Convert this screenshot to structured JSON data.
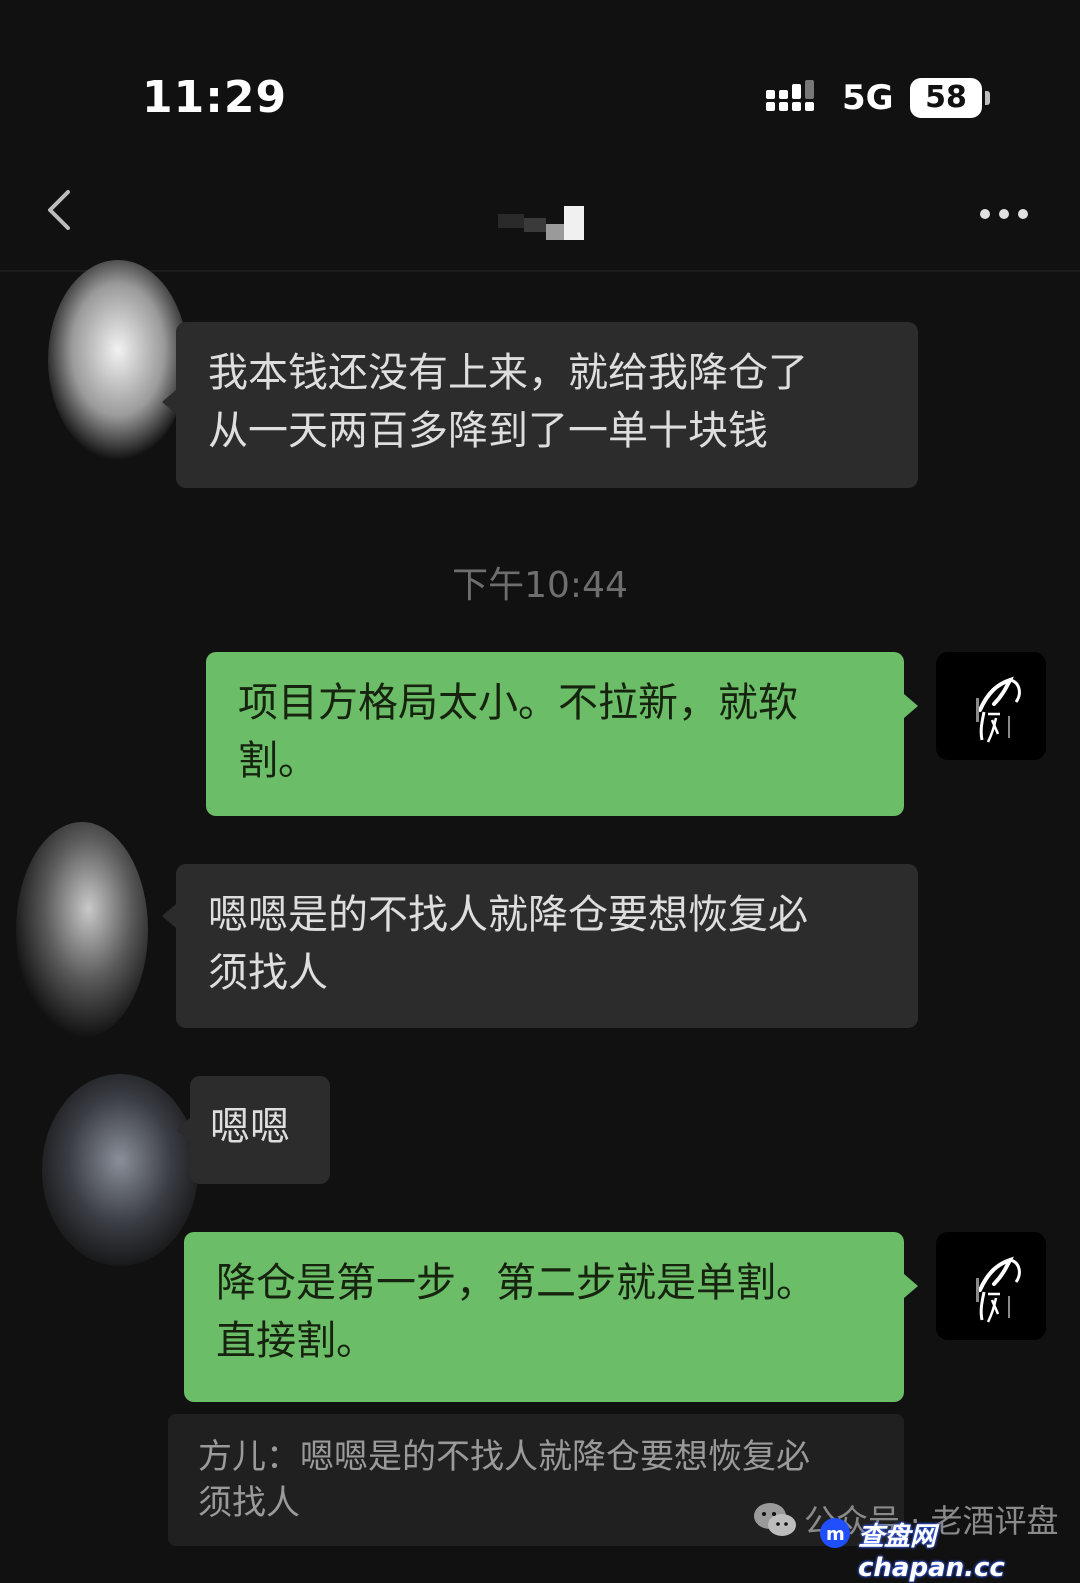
{
  "status_bar": {
    "time": "11:29",
    "network": "5G",
    "battery": "58"
  },
  "nav": {
    "back_icon": "chevron-left-icon",
    "more_icon": "ellipsis-icon"
  },
  "messages": [
    {
      "side": "in",
      "text": "我本钱还没有上来，就给我降仓了\n从一天两百多降到了一单十块钱"
    },
    {
      "type": "timestamp",
      "text": "下午10:44"
    },
    {
      "side": "out",
      "text": "项目方格局太小。不拉新，就软\n割。"
    },
    {
      "side": "in",
      "text": "嗯嗯是的不找人就降仓要想恢复必\n须找人"
    },
    {
      "side": "in",
      "text": "嗯嗯"
    },
    {
      "side": "out",
      "text": "降仓是第一步，第二步就是单割。\n直接割。"
    }
  ],
  "quote": {
    "text": "方儿：嗯嗯是的不找人就降仓要想恢复必\n须找人"
  },
  "watermark": {
    "text": "公众号 · 老酒评盘",
    "site": "查盘网 chapan.cc"
  },
  "colors": {
    "background": "#111111",
    "incoming_bubble": "#2c2c2c",
    "outgoing_bubble": "#6cbd67",
    "timestamp": "#6e6e6e"
  }
}
